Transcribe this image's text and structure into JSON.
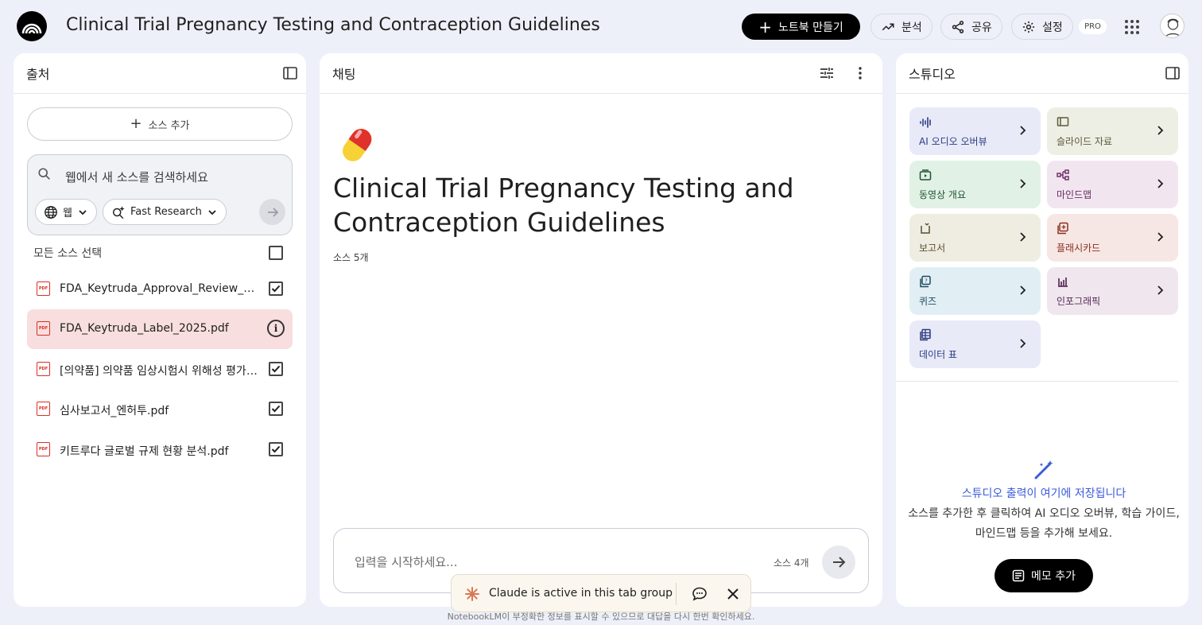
{
  "header": {
    "title": "Clinical Trial Pregnancy Testing and Contraception Guidelines",
    "create_label": "노트북 만들기",
    "analyze_label": "분석",
    "share_label": "공유",
    "settings_label": "설정",
    "pro_badge": "PRO"
  },
  "sources": {
    "panel_title": "출처",
    "add_label": "소스 추가",
    "search_placeholder": "웹에서 새 소스를 검색하세요",
    "web_chip": "웹",
    "research_chip": "Fast Research",
    "select_all_label": "모든 소스 선택",
    "items": [
      {
        "name": "FDA_Keytruda_Approval_Review_20...",
        "checked": true
      },
      {
        "name": "FDA_Keytruda_Label_2025.pdf",
        "active": true
      },
      {
        "name": "[의약품] 의약품 임상시험시 위해성 평가 ...",
        "checked": true
      },
      {
        "name": "심사보고서_엔허투.pdf",
        "checked": true
      },
      {
        "name": "키트루다 글로벌 규제 현황 분석.pdf",
        "checked": true
      }
    ],
    "pdf_icon_text": "PDF"
  },
  "chat": {
    "panel_title": "채팅",
    "notebook_title": "Clinical Trial Pregnancy Testing and Contraception Guidelines",
    "source_count": "소스 5개",
    "input_placeholder": "입력을 시작하세요...",
    "input_source_count": "소스 4개"
  },
  "studio": {
    "panel_title": "스튜디오",
    "tiles": [
      {
        "label": "AI 오디오 오버뷰",
        "icon": "audio-waveform-icon",
        "bg": "#e8eaf8",
        "color": "#2c3a80"
      },
      {
        "label": "슬라이드 자료",
        "icon": "slides-icon",
        "bg": "#eeefe4",
        "color": "#5a5a3a"
      },
      {
        "label": "동영상 개요",
        "icon": "video-icon",
        "bg": "#e2f1e6",
        "color": "#1f5230"
      },
      {
        "label": "마인드맵",
        "icon": "mindmap-icon",
        "bg": "#f1e6f0",
        "color": "#6a2a60"
      },
      {
        "label": "보고서",
        "icon": "report-icon",
        "bg": "#efede2",
        "color": "#5a4e2a"
      },
      {
        "label": "플래시카드",
        "icon": "flashcard-icon",
        "bg": "#f7e7e4",
        "color": "#8a3020"
      },
      {
        "label": "퀴즈",
        "icon": "quiz-icon",
        "bg": "#e1eff4",
        "color": "#1f4a60"
      },
      {
        "label": "인포그래픽",
        "icon": "infographic-icon",
        "bg": "#efe6ee",
        "color": "#5a2a55"
      },
      {
        "label": "데이터 표",
        "icon": "data-table-icon",
        "bg": "#e8eaf8",
        "color": "#2c3a80"
      }
    ],
    "empty_title": "스튜디오 출력이 여기에 저장됩니다",
    "empty_desc": "소스를 추가한 후 클릭하여 AI 오디오 오버뷰, 학습 가이드, 마인드맵 등을 추가해 보세요.",
    "memo_label": "메모 추가"
  },
  "claude_bar": {
    "text": "Claude is active in this tab group"
  },
  "footer": {
    "note": "NotebookLM이 부정확한 정보를 표시할 수 있으므로 대답을 다시 한번 확인하세요."
  }
}
